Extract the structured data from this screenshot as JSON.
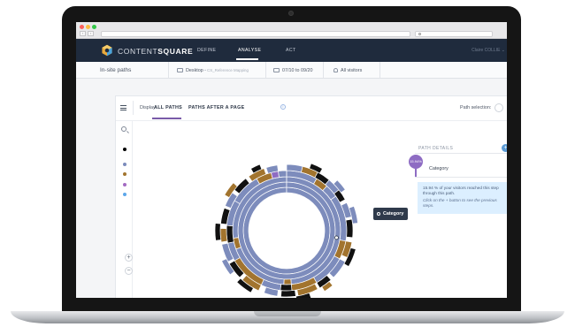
{
  "brand": {
    "light": "CONTENT",
    "bold": "SQUARE"
  },
  "nav": {
    "define": "DEFINE",
    "analyse": "ANALYSE",
    "act": "ACT"
  },
  "user": {
    "name": "Claire COLLIE"
  },
  "subbar": {
    "title": "In-site paths",
    "device": "Desktop",
    "mapping": "• CS_Reference Mapping",
    "date_from": "07/10",
    "date_to_label": "to",
    "date_to": "09/20",
    "segment": "All visitors"
  },
  "toolbar": {
    "display_label": "Display:",
    "tab_all_paths": "ALL PATHS",
    "tab_paths_after": "PATHS AFTER A PAGE",
    "path_selection": "Path selection:"
  },
  "legend": {
    "colors": [
      "#000000",
      "#7b8bbb",
      "#a2742e",
      "#a36ac2",
      "#5da7ea"
    ]
  },
  "zoom": {
    "in": "+",
    "out": "−"
  },
  "tooltip": {
    "label": "Category"
  },
  "path_details": {
    "title": "PATH DETAILS",
    "percent": "15.94%",
    "step": "Category",
    "info": "15.94 % of your visitors reached this step through this path.",
    "hint": "Click on the + button to see the previous steps."
  },
  "colors": {
    "blue": "#7d8cbc",
    "brown": "#a2742e",
    "black": "#111111",
    "purple": "#8e6cc3",
    "navbar": "#1f2b3d"
  }
}
